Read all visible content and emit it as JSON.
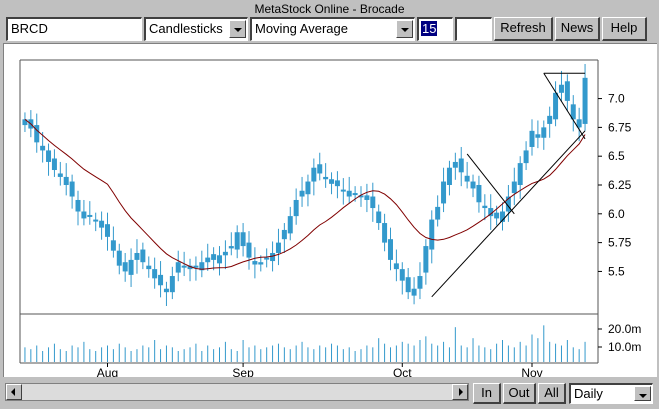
{
  "window": {
    "title": "MetaStock Online - Brocade"
  },
  "toolbar": {
    "symbol_value": "BRCD",
    "chart_style": "Candlesticks",
    "indicator": "Moving Average",
    "period": "15",
    "extra_value": "",
    "refresh_label": "Refresh",
    "news_label": "News",
    "help_label": "Help"
  },
  "bottom": {
    "zoom_in_label": "In",
    "zoom_out_label": "Out",
    "all_label": "All",
    "periodicity": "Daily"
  },
  "colors": {
    "candle": "#3399cc",
    "moving_average": "#800000",
    "trend_line": "#000000",
    "volume": "#3399cc"
  },
  "chart_data": {
    "type": "candlestick",
    "price_ylim": [
      5.2,
      7.3
    ],
    "price_ticks": [
      "7.0",
      "6.75",
      "6.5",
      "6.25",
      "6.0",
      "5.75",
      "5.5"
    ],
    "volume_ticks": [
      "20.0m",
      "10.0m"
    ],
    "x_labels": [
      "Aug",
      "Sep",
      "Oct",
      "Nov"
    ],
    "moving_average_period": 15,
    "closes": [
      6.82,
      6.74,
      6.62,
      6.55,
      6.45,
      6.38,
      6.32,
      6.25,
      6.15,
      6.02,
      5.96,
      5.98,
      5.94,
      5.88,
      5.8,
      5.68,
      5.55,
      5.5,
      5.6,
      5.66,
      5.58,
      5.52,
      5.44,
      5.38,
      5.32,
      5.46,
      5.58,
      5.55,
      5.52,
      5.54,
      5.58,
      5.62,
      5.6,
      5.64,
      5.67,
      5.72,
      5.84,
      5.72,
      5.62,
      5.56,
      5.58,
      5.62,
      5.66,
      5.75,
      5.86,
      5.98,
      6.12,
      6.2,
      6.28,
      6.4,
      6.35,
      6.3,
      6.26,
      6.24,
      6.2,
      6.15,
      6.18,
      6.16,
      6.12,
      6.05,
      5.92,
      5.75,
      5.6,
      5.52,
      5.42,
      5.32,
      5.35,
      5.46,
      5.72,
      5.95,
      6.06,
      6.28,
      6.4,
      6.45,
      6.36,
      6.28,
      6.22,
      6.1,
      6.05,
      5.98,
      5.96,
      6.02,
      6.15,
      6.28,
      6.44,
      6.55,
      6.72,
      6.66,
      6.75,
      6.85,
      7.05,
      7.12,
      6.98,
      6.82,
      6.75,
      7.18
    ],
    "volume_m": [
      8,
      7,
      9,
      6,
      8,
      10,
      7,
      6,
      9,
      8,
      11,
      7,
      6,
      8,
      9,
      7,
      10,
      8,
      6,
      7,
      9,
      8,
      12,
      7,
      9,
      8,
      6,
      7,
      8,
      10,
      6,
      9,
      7,
      8,
      11,
      7,
      6,
      12,
      8,
      9,
      7,
      8,
      9,
      10,
      8,
      7,
      9,
      11,
      8,
      7,
      9,
      8,
      10,
      9,
      7,
      8,
      6,
      7,
      9,
      8,
      13,
      10,
      8,
      9,
      11,
      10,
      9,
      12,
      14,
      10,
      9,
      11,
      8,
      19,
      9,
      8,
      13,
      9,
      8,
      7,
      10,
      12,
      9,
      8,
      11,
      9,
      15,
      13,
      20,
      11,
      10,
      9,
      12,
      8,
      7,
      11
    ],
    "trend_lines": [
      {
        "from": [
          "Oct-start",
          5.28
        ],
        "to": [
          "Nov-end",
          6.72
        ]
      },
      {
        "from": [
          "Oct-mid",
          6.52
        ],
        "to": [
          "Oct-late",
          6.0
        ]
      },
      {
        "from": [
          "Nov-early",
          7.22
        ],
        "to": [
          "Nov-end",
          6.65
        ]
      },
      {
        "from": [
          "Nov-early",
          7.22
        ],
        "to": [
          "Nov-end",
          7.22
        ]
      }
    ]
  }
}
